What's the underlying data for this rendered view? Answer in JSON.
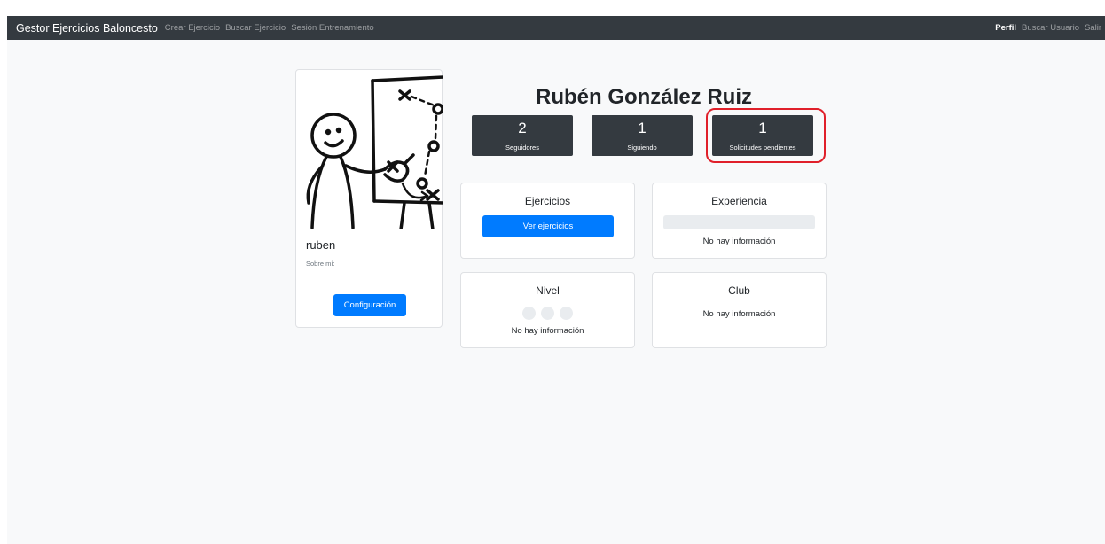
{
  "navbar": {
    "brand": "Gestor Ejercicios Baloncesto",
    "links": [
      "Crear Ejercicio",
      "Buscar Ejercicio",
      "Sesión Entrenamiento"
    ],
    "right_links": [
      "Perfil",
      "Buscar Usuario",
      "Salir"
    ]
  },
  "profile": {
    "username": "ruben",
    "about_label": "Sobre mí:",
    "config_button": "Configuración"
  },
  "user": {
    "full_name": "Rubén González Ruiz"
  },
  "stats": [
    {
      "value": "2",
      "label": "Seguidores"
    },
    {
      "value": "1",
      "label": "Siguiendo"
    },
    {
      "value": "1",
      "label": "Solicitudes pendientes"
    }
  ],
  "cards": {
    "ejercicios": {
      "title": "Ejercicios",
      "button": "Ver ejercicios"
    },
    "experiencia": {
      "title": "Experiencia",
      "text": "No hay información",
      "progress": 0
    },
    "nivel": {
      "title": "Nivel",
      "text": "No hay información",
      "rating_filled": 0,
      "rating_max": 3
    },
    "club": {
      "title": "Club",
      "text": "No hay información"
    }
  },
  "colors": {
    "navbar": "#343a40",
    "primary": "#007bff",
    "highlight": "#e0202a"
  }
}
